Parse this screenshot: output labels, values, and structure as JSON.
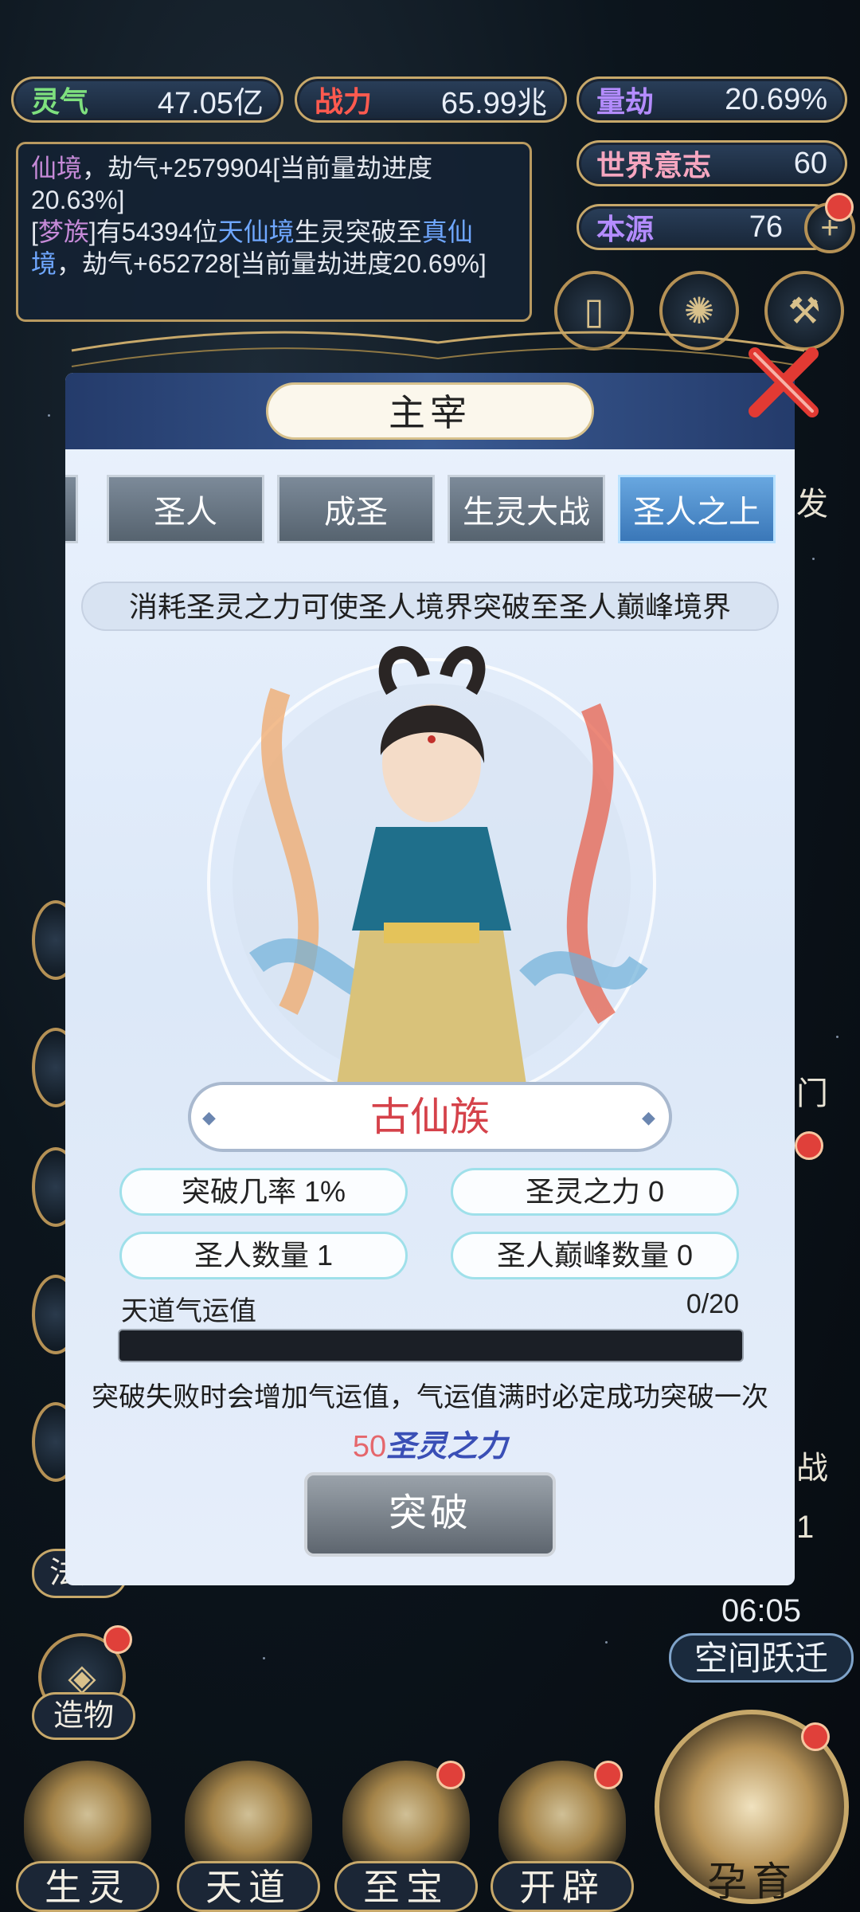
{
  "top_stats": {
    "lingqi": {
      "label": "灵气",
      "value": "47.05亿"
    },
    "zhanli": {
      "label": "战力",
      "value": "65.99兆"
    },
    "liangjie": {
      "label": "量劫",
      "value": "20.69%"
    },
    "shijie": {
      "label": "世界意志",
      "value": "60"
    },
    "benyuan": {
      "label": "本源",
      "value": "76"
    }
  },
  "log": {
    "line1_realm": "仙境",
    "line1_rest": "，劫气+2579904[当前量劫进度20.63%]",
    "line2_open": "[",
    "line2_clan": "梦族",
    "line2_mid": "]有54394位",
    "line2_realm1": "天仙境",
    "line2_mid2": "生灵突破至",
    "line2_realm2": "真仙境",
    "line2_rest": "，劫气+652728[当前量劫进度20.69%]"
  },
  "right_side": {
    "fa_label": "发",
    "men_label": "门",
    "zhan_label": "战",
    "num_label": "1",
    "timer": "06:05",
    "space_jump": "空间跃迁"
  },
  "left_side": {
    "fa_ze": "法则",
    "zao_wu": "造物"
  },
  "bottom_nav": [
    "生灵",
    "天道",
    "至宝",
    "开辟"
  ],
  "yun_yu": "孕育",
  "modal": {
    "title": "主宰",
    "tabs": [
      "圣人",
      "成圣",
      "生灵大战",
      "圣人之上"
    ],
    "active_tab": "圣人之上",
    "description": "消耗圣灵之力可使圣人境界突破至圣人巅峰境界",
    "race_name": "古仙族",
    "stats": {
      "break_rate": "突破几率 1%",
      "holy_power": "圣灵之力 0",
      "saint_count": "圣人数量 1",
      "peak_count": "圣人巅峰数量 0"
    },
    "luck_label": "天道气运值",
    "luck_value": "0/20",
    "luck_progress": 0,
    "note": "突破失败时会增加气运值，气运值满时必定成功突破一次",
    "cost_amount": "50",
    "cost_item": "圣灵之力",
    "break_button": "突破"
  },
  "colors": {
    "accent_gold": "#c7a86a",
    "lingqi_green": "#7ee07e",
    "zhanli_red": "#ff5a4f",
    "liangjie_purple": "#b48cff"
  }
}
